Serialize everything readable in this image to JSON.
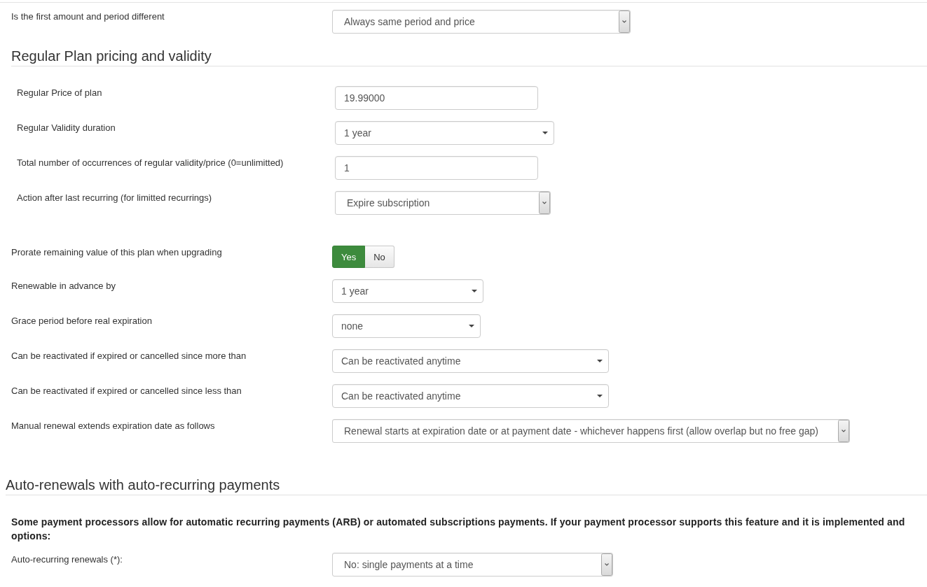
{
  "first_period": {
    "label": "Is the first amount and period different",
    "control": {
      "kind": "dropdown",
      "value": "Always same period and price"
    }
  },
  "regular_plan": {
    "heading": "Regular Plan pricing and validity",
    "rows": [
      {
        "label": "Regular Price of plan",
        "control": {
          "kind": "input",
          "value": "19.99000"
        }
      },
      {
        "label": "Regular Validity duration",
        "control": {
          "kind": "select",
          "value": "1 year"
        }
      },
      {
        "label": "Total number of occurrences of regular validity/price (0=unlimitted)",
        "control": {
          "kind": "input",
          "value": "1"
        }
      },
      {
        "label": "Action after last recurring (for limitted recurrings)",
        "control": {
          "kind": "dropdown",
          "value": "Expire subscription"
        }
      }
    ]
  },
  "renewal": {
    "rows": [
      {
        "label": "Prorate remaining value of this plan when upgrading",
        "control": {
          "kind": "toggle",
          "options": [
            {
              "label": "Yes",
              "selected": true
            },
            {
              "label": "No",
              "selected": false
            }
          ]
        }
      },
      {
        "label": "Renewable in advance by",
        "control": {
          "kind": "select",
          "value": "1 year"
        }
      },
      {
        "label": "Grace period before real expiration",
        "control": {
          "kind": "select",
          "value": "none"
        }
      },
      {
        "label": "Can be reactivated if expired or cancelled since more than",
        "control": {
          "kind": "select",
          "value": "Can be reactivated anytime"
        }
      },
      {
        "label": "Can be reactivated if expired or cancelled since less than",
        "control": {
          "kind": "select",
          "value": "Can be reactivated anytime"
        }
      },
      {
        "label": "Manual renewal extends expiration date as follows",
        "control": {
          "kind": "dropdown",
          "value": "Renewal starts at expiration date or at payment date - whichever happens first (allow overlap but no free gap)"
        }
      }
    ]
  },
  "auto_renewals": {
    "heading": "Auto-renewals with auto-recurring payments",
    "notice_lines": [
      "Some payment processors allow for automatic recurring payments (ARB) or automated subscriptions payments. If your payment processor supports this feature and it is implemented and",
      "options:"
    ],
    "rows": [
      {
        "label": "Auto-recurring renewals (*):",
        "control": {
          "kind": "dropdown",
          "value": "No: single payments at a time"
        }
      }
    ]
  }
}
